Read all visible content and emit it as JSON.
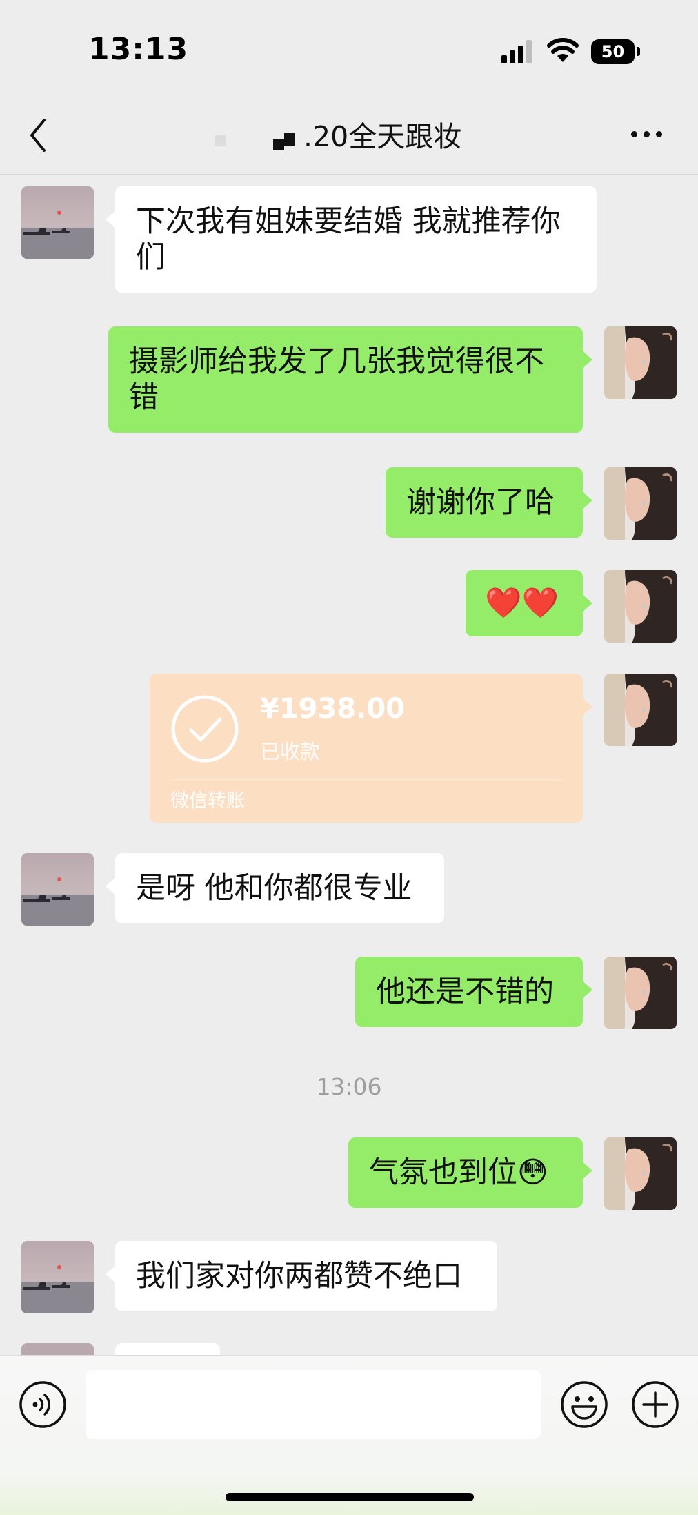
{
  "status_bar": {
    "time": "13:13",
    "battery": "50"
  },
  "nav": {
    "title": ".20全天跟妆"
  },
  "messages": [
    {
      "from": "other",
      "text": "下次我有姐妹要结婚 我就推荐你们"
    },
    {
      "from": "me",
      "text": "摄影师给我发了几张我觉得很不错"
    },
    {
      "from": "me",
      "text": "谢谢你了哈"
    },
    {
      "from": "me",
      "text": "❤️❤️"
    },
    {
      "from": "other",
      "text": "是呀 他和你都很专业"
    },
    {
      "from": "me",
      "text": "他还是不错的"
    },
    {
      "from": "me",
      "text": "气氛也到位😳"
    },
    {
      "from": "other",
      "text": "我们家对你两都赞不绝口"
    }
  ],
  "transfer": {
    "amount": "¥1938.00",
    "status": "已收款",
    "label": "微信转账"
  },
  "timestamp": "13:06",
  "input": {
    "value": ""
  },
  "colors": {
    "background": "#ededed",
    "outgoing_bubble": "#95ec69",
    "incoming_bubble": "#ffffff",
    "transfer_card": "#fcdfc3"
  }
}
